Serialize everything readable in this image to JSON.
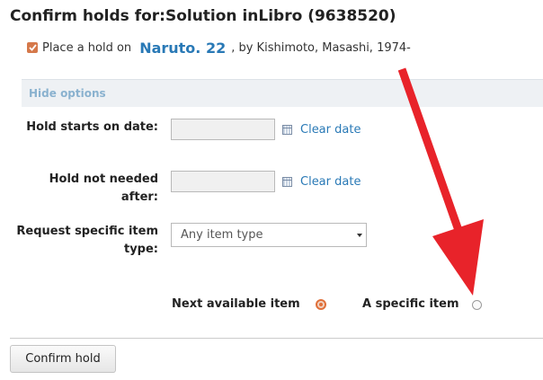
{
  "page": {
    "title": "Confirm holds for:Solution inLibro (9638520)"
  },
  "hold": {
    "checked": true,
    "prefix": "Place a hold on",
    "title_link": "Naruto. 22",
    "author": ", by Kishimoto, Masashi, 1974-"
  },
  "options": {
    "hide_label": "Hide options",
    "hold_starts_label": "Hold starts on date:",
    "hold_not_needed_label": "Hold not needed after:",
    "clear_date": "Clear date",
    "request_item_type_label": "Request specific item type:",
    "item_type_selected": "Any item type",
    "next_available": "Next available item",
    "specific_item": "A specific item",
    "selected_option": "Next available item"
  },
  "actions": {
    "confirm_label": "Confirm hold"
  },
  "annotation": {
    "arrow_color": "#e8232a"
  },
  "colors": {
    "link": "#2979b6",
    "accent": "#e0703a",
    "panel_bg": "#eef1f4"
  }
}
